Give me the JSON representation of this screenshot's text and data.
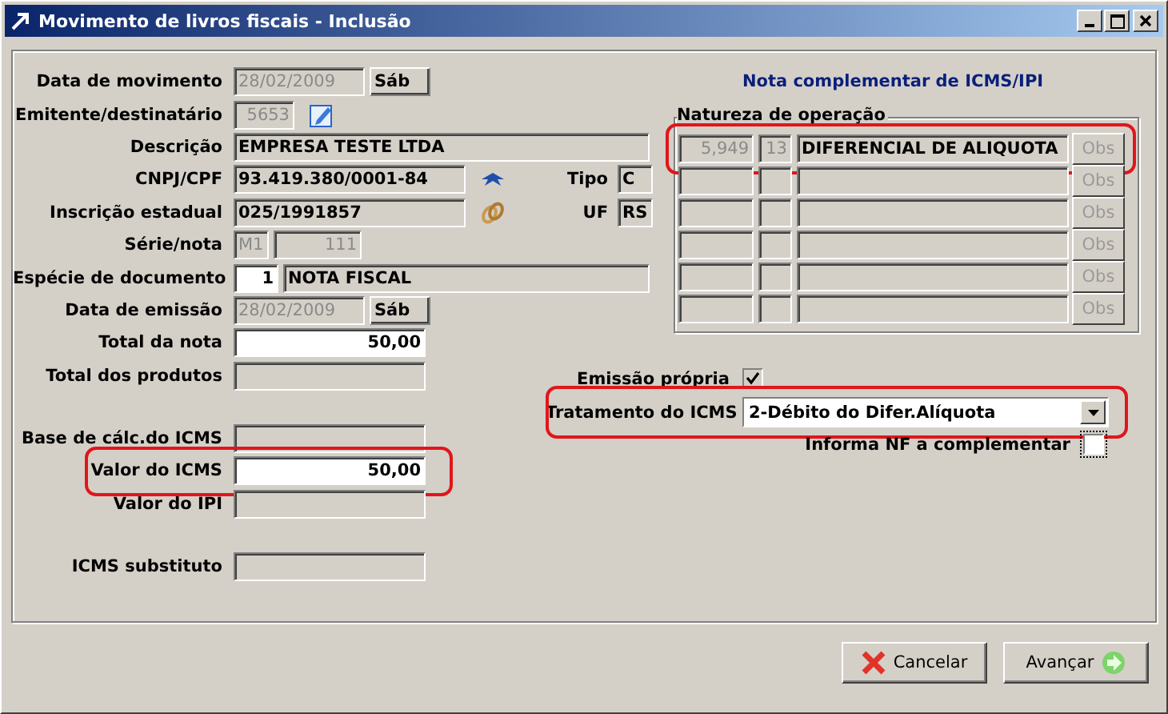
{
  "window": {
    "title": "Movimento de livros fiscais - Inclusão"
  },
  "left_sections": [
    [
      {
        "kind": "plain",
        "label": "Data de movimento",
        "highlighted": false,
        "inputs": [
          {
            "kind": "date",
            "value": "28/02/2009",
            "disabled": true
          },
          {
            "kind": "day",
            "value": "Sáb",
            "disabled": false
          }
        ]
      },
      {
        "kind": "edit",
        "label": "Emitente/destinatário",
        "highlighted": false,
        "inputs": [
          {
            "kind": "code",
            "value": "5653",
            "disabled": true
          }
        ]
      },
      {
        "kind": "plain",
        "label": "Descrição",
        "highlighted": false,
        "inputs": [
          {
            "kind": "wide",
            "value": "EMPRESA TESTE LTDA",
            "disabled": false
          }
        ]
      },
      {
        "kind": "bird",
        "label": "CNPJ/CPF",
        "highlighted": false,
        "inputs": [
          {
            "kind": "doc",
            "value": "93.419.380/0001-84",
            "disabled": false
          }
        ],
        "side": {
          "label": "Tipo",
          "value": "C"
        }
      },
      {
        "kind": "link",
        "label": "Inscrição estadual",
        "highlighted": false,
        "inputs": [
          {
            "kind": "doc",
            "value": "025/1991857",
            "disabled": false
          }
        ],
        "side": {
          "label": "UF",
          "value": "RS"
        }
      },
      {
        "kind": "plain",
        "label": "Série/nota",
        "highlighted": false,
        "inputs": [
          {
            "kind": "series",
            "value": "M1",
            "disabled": true
          },
          {
            "kind": "number",
            "value": "111",
            "disabled": true
          }
        ]
      },
      {
        "kind": "plain",
        "label": "Espécie de documento",
        "highlighted": false,
        "inputs": [
          {
            "kind": "small",
            "value": "1",
            "disabled": false,
            "editable": true
          },
          {
            "kind": "rest",
            "value": "NOTA FISCAL",
            "disabled": false
          }
        ]
      },
      {
        "kind": "plain",
        "label": "Data de emissão",
        "highlighted": false,
        "inputs": [
          {
            "kind": "date",
            "value": "28/02/2009",
            "disabled": true
          },
          {
            "kind": "day",
            "value": "Sáb",
            "disabled": false
          }
        ]
      },
      {
        "kind": "plain",
        "label": "Total da nota",
        "highlighted": false,
        "inputs": [
          {
            "kind": "amount",
            "value": "50,00",
            "disabled": false,
            "editable": true
          }
        ]
      },
      {
        "kind": "plain",
        "label": "Total dos produtos",
        "highlighted": false,
        "inputs": [
          {
            "kind": "amount",
            "editable": false
          }
        ]
      }
    ],
    [
      {
        "kind": "plain",
        "label": "Base de cálc.do ICMS",
        "highlighted": false,
        "inputs": [
          {
            "kind": "amount",
            "editable": false
          }
        ]
      },
      {
        "kind": "plain",
        "label": "Valor do ICMS",
        "highlighted": true,
        "inputs": [
          {
            "kind": "amount",
            "value": "50,00",
            "disabled": false,
            "editable": true
          }
        ]
      },
      {
        "kind": "plain",
        "label": "Valor do IPI",
        "highlighted": false,
        "inputs": [
          {
            "kind": "amount",
            "editable": false
          }
        ]
      }
    ],
    [
      {
        "kind": "plain",
        "label": "ICMS substituto",
        "highlighted": false,
        "inputs": [
          {
            "kind": "amount",
            "editable": false
          }
        ]
      }
    ]
  ],
  "complement": {
    "title": "Nota complementar de ICMS/IPI",
    "group_label": "Natureza de operação",
    "rows": [
      {
        "code": "5,949",
        "number": "13",
        "description": "DIFERENCIAL DE ALIQUOTA",
        "button": "Obs",
        "button_disabled": true,
        "highlighted": true
      },
      {
        "button": "Obs",
        "button_disabled": true,
        "highlighted": false
      },
      {
        "button": "Obs",
        "button_disabled": true,
        "highlighted": false
      },
      {
        "button": "Obs",
        "button_disabled": true,
        "highlighted": false
      },
      {
        "button": "Obs",
        "button_disabled": true,
        "highlighted": false
      },
      {
        "button": "Obs",
        "button_disabled": true,
        "highlighted": false
      }
    ]
  },
  "emissao_propria": {
    "label": "Emissão própria",
    "checked": true
  },
  "tratamento": {
    "label": "Tratamento do ICMS",
    "value": "2-Débito do Difer.Alíquota",
    "highlighted": true
  },
  "informa_nf": {
    "label": "Informa NF a complementar",
    "checked": false
  },
  "buttons": [
    {
      "kind": "cancel",
      "label": "Cancelar"
    },
    {
      "kind": "next",
      "label": "Avançar"
    }
  ]
}
